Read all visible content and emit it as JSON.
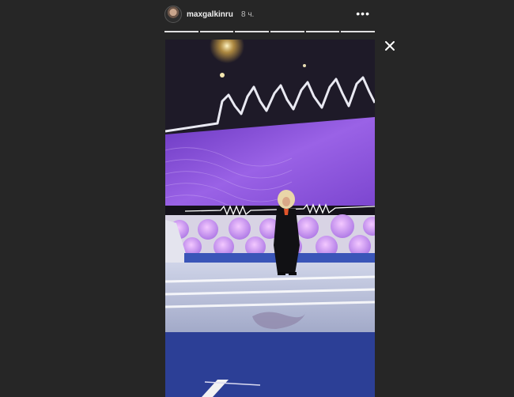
{
  "story": {
    "username": "maxgalkinru",
    "time_ago": "8 ч.",
    "more_label": "•••",
    "progress_segments": 6,
    "progress_current": 6
  },
  "icons": {
    "avatar": "avatar-image",
    "more": "more-options-icon",
    "close": "close-icon"
  },
  "colors": {
    "background": "#262626",
    "screen_purple": "#8a52d8",
    "stage_floor": "#2c3f96"
  }
}
